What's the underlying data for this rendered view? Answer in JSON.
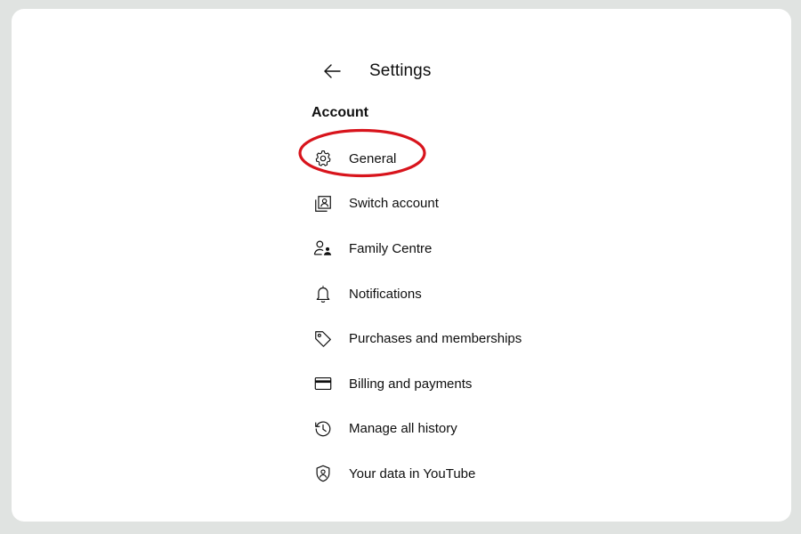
{
  "header": {
    "title": "Settings",
    "back_icon": "arrow-left-icon"
  },
  "section": {
    "heading": "Account"
  },
  "menu": {
    "items": [
      {
        "label": "General",
        "icon": "gear-icon",
        "highlighted": true
      },
      {
        "label": "Switch account",
        "icon": "switch-account-icon"
      },
      {
        "label": "Family Centre",
        "icon": "family-icon"
      },
      {
        "label": "Notifications",
        "icon": "bell-icon"
      },
      {
        "label": "Purchases and memberships",
        "icon": "tag-icon"
      },
      {
        "label": "Billing and payments",
        "icon": "credit-card-icon"
      },
      {
        "label": "Manage all history",
        "icon": "history-icon"
      },
      {
        "label": "Your data in YouTube",
        "icon": "shield-person-icon"
      }
    ]
  },
  "colors": {
    "highlight": "#d8141c",
    "text": "#0f0f0f",
    "background": "#e0e3e1",
    "card": "#ffffff"
  }
}
